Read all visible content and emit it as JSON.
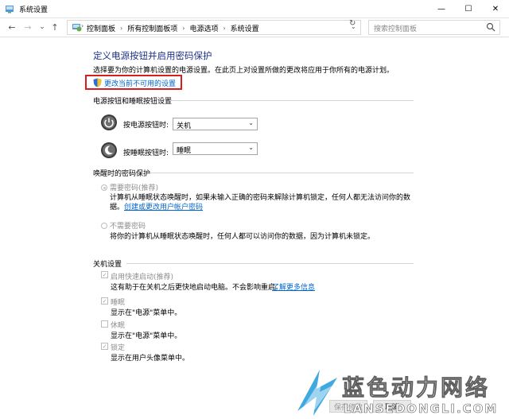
{
  "window": {
    "title": "系统设置",
    "minimize_glyph": "—",
    "maximize_glyph": "☐",
    "close_glyph": "✕"
  },
  "address": {
    "back_glyph": "←",
    "forward_glyph": "→",
    "recent_glyph": "⌄",
    "up_glyph": "↑",
    "breadcrumbs": [
      "控制面板",
      "所有控制面板项",
      "电源选项",
      "系统设置"
    ],
    "separator": "›",
    "dropdown_glyph": "⌄",
    "refresh_glyph": "↻",
    "search_placeholder": "搜索控制面板"
  },
  "main": {
    "heading": "定义电源按钮并启用密码保护",
    "description": "选择要为你的计算机设置的电源设置。在此页上对设置所做的更改将应用于你所有的电源计划。",
    "change_link": "更改当前不可用的设置",
    "power_section": {
      "title": "电源按钮和睡眠按钮设置",
      "power_label": "按电源按钮时:",
      "power_value": "关机",
      "sleep_label": "按睡眠按钮时:",
      "sleep_value": "睡眠"
    },
    "password_section": {
      "title": "唤醒时的密码保护",
      "require_label": "需要密码(推荐)",
      "require_desc_1": "计算机从睡眠状态唤醒时，如果未输入正确的密码来解除计算机锁定，任何人都无法访问你的数",
      "require_desc_2": "据。",
      "create_link": "创建或更改用户帐户密码",
      "norequire_label": "不需要密码",
      "norequire_desc": "将你的计算机从睡眠状态唤醒时，任何人都可以访问你的数据，因为计算机未锁定。"
    },
    "shutdown_section": {
      "title": "关机设置",
      "fast_label": "启用快速启动(推荐)",
      "fast_desc": "这有助于在关机之后更快地启动电脑。不会影响重启。",
      "learn_more": "了解更多信息",
      "sleep_label": "睡眠",
      "sleep_desc": "显示在\"电源\"菜单中。",
      "hibernate_label": "休眠",
      "hibernate_desc": "显示在\"电源\"菜单中。",
      "lock_label": "锁定",
      "lock_desc": "显示在用户头像菜单中。"
    },
    "save_button": "保存修改",
    "cancel_button": "取消",
    "checkmark": "✓"
  },
  "watermark": {
    "text": "蓝色动力网络",
    "url": "LANSEDONGLI.COM"
  }
}
